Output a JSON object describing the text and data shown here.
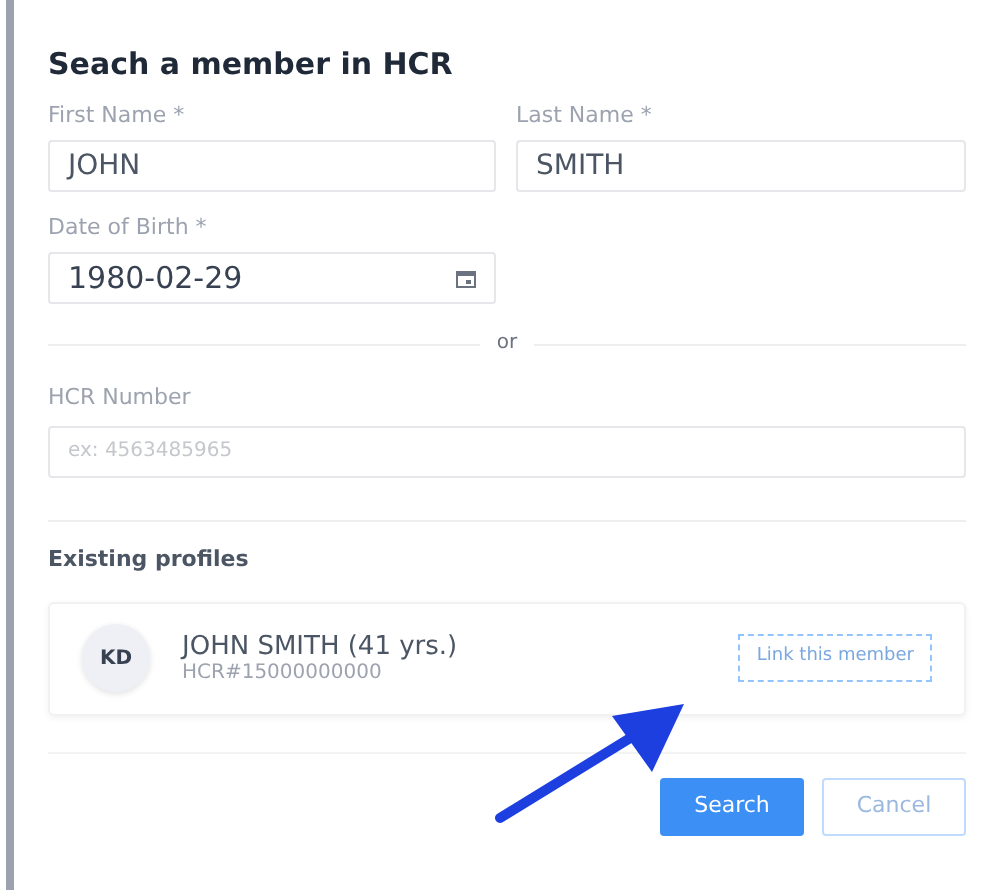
{
  "title": "Seach a member in HCR",
  "fields": [
    {
      "label": "First Name *",
      "value": "JOHN",
      "kind": "text"
    },
    {
      "label": "Last Name *",
      "value": "SMITH",
      "kind": "text"
    },
    {
      "label": "Date of Birth *",
      "value": "1980-02-29",
      "kind": "date"
    }
  ],
  "separator": "or",
  "hcr_field": {
    "label": "HCR Number",
    "placeholder": "ex: 4563485965"
  },
  "profiles_heading": "Existing profiles",
  "profiles": [
    {
      "initials": "KD",
      "name": "JOHN SMITH (41 yrs.)",
      "hcr": "HCR#15000000000",
      "action": "Link this member"
    }
  ],
  "buttons": [
    {
      "label": "Search",
      "kind": "primary"
    },
    {
      "label": "Cancel",
      "kind": "secondary"
    }
  ]
}
